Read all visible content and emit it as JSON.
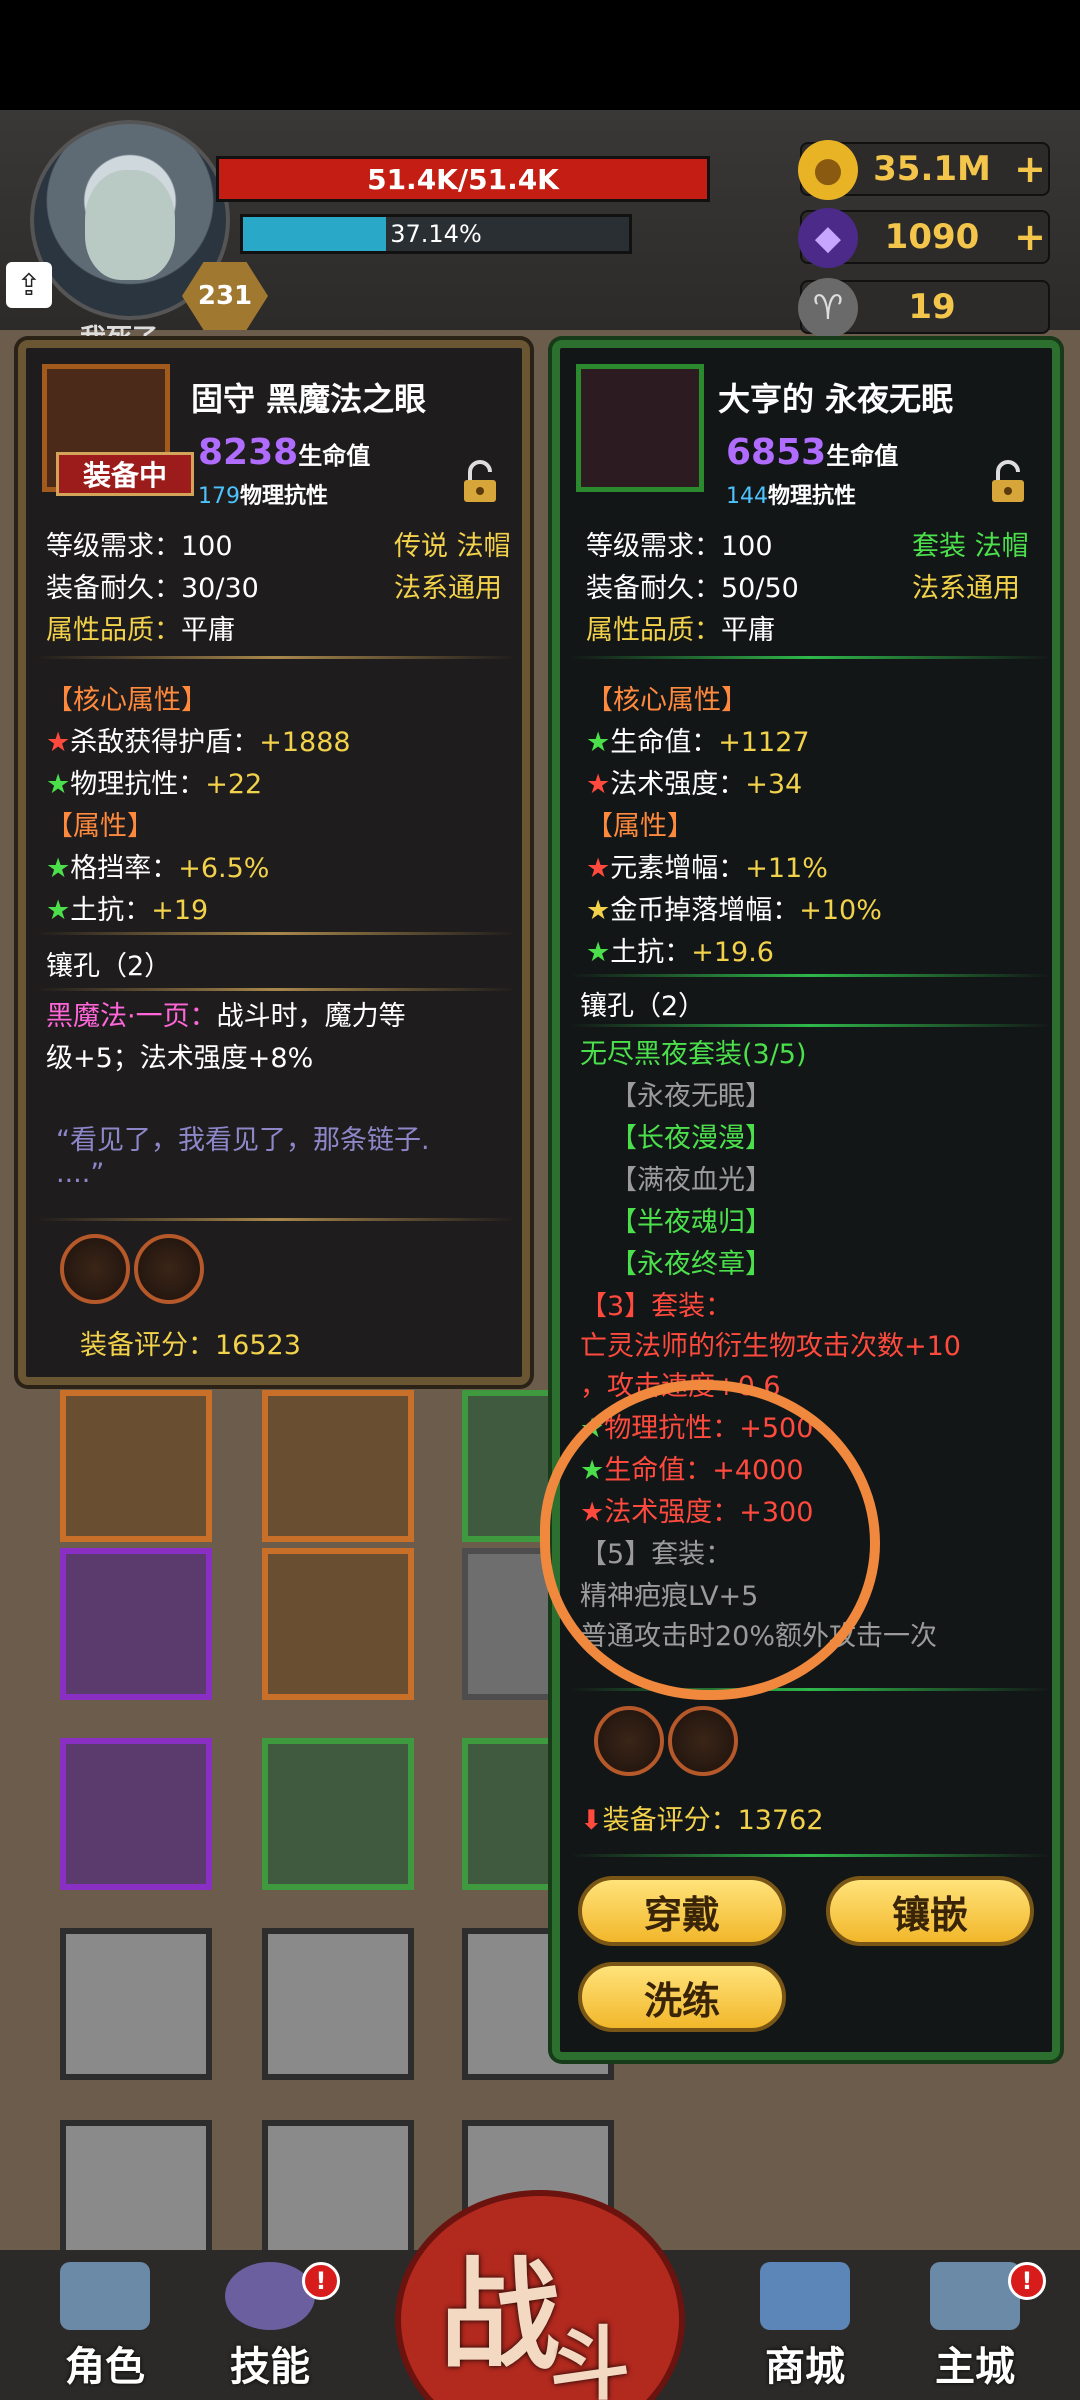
{
  "player": {
    "hp_text": "51.4K/51.4K",
    "exp_text": "37.14%",
    "exp_fraction": 0.3714,
    "level": "231",
    "status_text": "我死了"
  },
  "resources": {
    "gold": "35.1M",
    "gems": "1090",
    "keys": "19"
  },
  "left_item": {
    "title": "固守 黑魔法之眼",
    "equipped_label": "装备中",
    "hp_value": "8238",
    "hp_label": "生命值",
    "armor_value": "179",
    "armor_label": "物理抗性",
    "level_req": "等级需求：100",
    "rarity_type": "传说 法帽",
    "durability": "装备耐久：30/30",
    "class": "法系通用",
    "quality_label": "属性品质：",
    "quality_value": "平庸",
    "core_header": "【核心属性】",
    "core_1_label": "杀敌获得护盾：",
    "core_1_value": "+1888",
    "core_2_label": "物理抗性：",
    "core_2_value": "+22",
    "attr_header": "【属性】",
    "attr_1_label": "格挡率：",
    "attr_1_value": "+6.5%",
    "attr_2_label": "土抗：",
    "attr_2_value": "+19",
    "sockets": "镶孔（2）",
    "skill_name": "黑魔法·一页：",
    "skill_desc_1": "战斗时，魔力等",
    "skill_desc_2": "级+5；法术强度+8%",
    "flavor_1": "“看见了，我看见了，那条链子.",
    "flavor_2": "....”",
    "score_label": "装备评分：",
    "score_value": "16523"
  },
  "right_item": {
    "title": "大亨的 永夜无眠",
    "hp_value": "6853",
    "hp_label": "生命值",
    "armor_value": "144",
    "armor_label": "物理抗性",
    "level_req": "等级需求：100",
    "rarity_type": "套装 法帽",
    "durability": "装备耐久：50/50",
    "class": "法系通用",
    "quality_label": "属性品质：",
    "quality_value": "平庸",
    "core_header": "【核心属性】",
    "core_1_label": "生命值：",
    "core_1_value": "+1127",
    "core_2_label": "法术强度：",
    "core_2_value": "+34",
    "attr_header": "【属性】",
    "attr_1_label": "元素增幅：",
    "attr_1_value": "+11%",
    "attr_2_label": "金币掉落增幅：",
    "attr_2_value": "+10%",
    "attr_3_label": "土抗：",
    "attr_3_value": "+19.6",
    "sockets": "镶孔（2）",
    "set_name": "无尽黑夜套装(3/5)",
    "set_pieces": [
      "【永夜无眠】",
      "【长夜漫漫】",
      "【满夜血光】",
      "【半夜魂归】",
      "【永夜终章】"
    ],
    "set3_header": "【3】套装：",
    "set3_line1": "亡灵法师的衍生物攻击次数+10",
    "set3_line2": "，攻击速度+0.6",
    "set3_b1_label": "物理抗性：",
    "set3_b1_value": "+500",
    "set3_b2_label": "生命值：",
    "set3_b2_value": "+4000",
    "set3_b3_label": "法术强度：",
    "set3_b3_value": "+300",
    "set5_header": "【5】套装：",
    "set5_line1": "精神疤痕LV+5",
    "set5_line2": "普通攻击时20%额外攻击一次",
    "score_label": "装备评分：",
    "score_value": "13762",
    "btn_wear": "穿戴",
    "btn_inlay": "镶嵌",
    "btn_refine": "洗练"
  },
  "nav": {
    "role": "角色",
    "skill": "技能",
    "battle_1": "战",
    "battle_2": "斗",
    "shop": "商城",
    "city": "主城",
    "badge": "!"
  }
}
